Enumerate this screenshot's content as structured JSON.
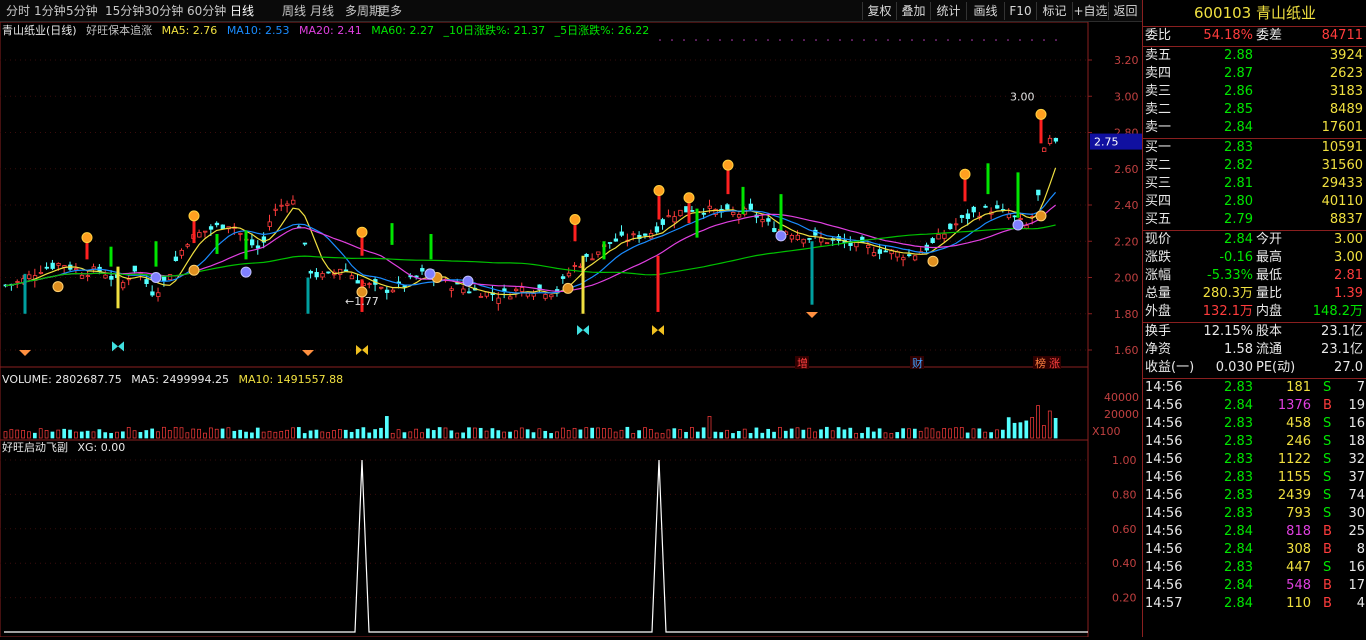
{
  "toolbar": {
    "periods": [
      "分时",
      "1分钟",
      "5分钟",
      "15分钟",
      "30分钟",
      "60分钟",
      "日线",
      "周线",
      "月线",
      "多周期",
      "更多"
    ],
    "active_period": "日线",
    "right_buttons": [
      "复权",
      "叠加",
      "统计",
      "画线",
      "F10",
      "标记",
      "+自选",
      "返回"
    ]
  },
  "header": {
    "code": "600103",
    "name": "青山纸业"
  },
  "main_chart": {
    "title": "青山纸业(日线)",
    "indicator": "好旺保本追涨",
    "ma5": "MA5: 2.76",
    "ma10": "MA10: 2.53",
    "ma20": "MA20: 2.41",
    "ma60": "MA60: 2.27",
    "chg10": "_10日涨跌%: 21.37",
    "chg5": "_5日涨跌%: 26.22",
    "price_ticks": [
      "3.20",
      "3.00",
      "2.80",
      "2.60",
      "2.40",
      "2.20",
      "2.00",
      "1.80",
      "1.60"
    ],
    "current_price_tag": "2.75",
    "high_label": "3.00",
    "low_label": "1.77",
    "markers": [
      "增",
      "财",
      "榜",
      "涨"
    ]
  },
  "volume_chart": {
    "title": "VOLUME: 2802687.75",
    "ma5": "MA5: 2499994.25",
    "ma10": "MA10: 1491557.88",
    "ticks": [
      "40000",
      "20000"
    ],
    "unit": "X100"
  },
  "sub_chart": {
    "title": "好旺启动飞副",
    "xg": "XG: 0.00",
    "ticks": [
      "1.00",
      "0.80",
      "0.60",
      "0.40",
      "0.20"
    ]
  },
  "quote": {
    "weibi_label": "委比",
    "weibi": "54.18%",
    "weicha_label": "委差",
    "weicha": "84711",
    "asks": [
      {
        "label": "卖五",
        "price": "2.88",
        "vol": "3924"
      },
      {
        "label": "卖四",
        "price": "2.87",
        "vol": "2623"
      },
      {
        "label": "卖三",
        "price": "2.86",
        "vol": "3183"
      },
      {
        "label": "卖二",
        "price": "2.85",
        "vol": "8489"
      },
      {
        "label": "卖一",
        "price": "2.84",
        "vol": "17601"
      }
    ],
    "bids": [
      {
        "label": "买一",
        "price": "2.83",
        "vol": "10591"
      },
      {
        "label": "买二",
        "price": "2.82",
        "vol": "31560"
      },
      {
        "label": "买三",
        "price": "2.81",
        "vol": "29433"
      },
      {
        "label": "买四",
        "price": "2.80",
        "vol": "40110"
      },
      {
        "label": "买五",
        "price": "2.79",
        "vol": "8837"
      }
    ],
    "stats": [
      {
        "l1": "现价",
        "v1": "2.84",
        "l2": "今开",
        "v2": "3.00"
      },
      {
        "l1": "涨跌",
        "v1": "-0.16",
        "l2": "最高",
        "v2": "3.00"
      },
      {
        "l1": "涨幅",
        "v1": "-5.33%",
        "l2": "最低",
        "v2": "2.81"
      },
      {
        "l1": "总量",
        "v1": "280.3万",
        "l2": "量比",
        "v2": "1.39"
      },
      {
        "l1": "外盘",
        "v1": "132.1万",
        "l2": "内盘",
        "v2": "148.2万"
      }
    ],
    "stats2": [
      {
        "l1": "换手",
        "v1": "12.15%",
        "l2": "股本",
        "v2": "23.1亿"
      },
      {
        "l1": "净资",
        "v1": "1.58",
        "l2": "流通",
        "v2": "23.1亿"
      },
      {
        "l1": "收益(一)",
        "v1": "0.030",
        "l2": "PE(动)",
        "v2": "27.0"
      }
    ]
  },
  "ticks_list": [
    {
      "time": "14:56",
      "price": "2.83",
      "vol": "181",
      "bs": "S",
      "n": "7"
    },
    {
      "time": "14:56",
      "price": "2.84",
      "vol": "1376",
      "bs": "B",
      "n": "19"
    },
    {
      "time": "14:56",
      "price": "2.83",
      "vol": "458",
      "bs": "S",
      "n": "16"
    },
    {
      "time": "14:56",
      "price": "2.83",
      "vol": "246",
      "bs": "S",
      "n": "18"
    },
    {
      "time": "14:56",
      "price": "2.83",
      "vol": "1122",
      "bs": "S",
      "n": "32"
    },
    {
      "time": "14:56",
      "price": "2.83",
      "vol": "1155",
      "bs": "S",
      "n": "37"
    },
    {
      "time": "14:56",
      "price": "2.83",
      "vol": "2439",
      "bs": "S",
      "n": "74"
    },
    {
      "time": "14:56",
      "price": "2.83",
      "vol": "793",
      "bs": "S",
      "n": "30"
    },
    {
      "time": "14:56",
      "price": "2.84",
      "vol": "818",
      "bs": "B",
      "n": "25"
    },
    {
      "time": "14:56",
      "price": "2.84",
      "vol": "308",
      "bs": "B",
      "n": "8"
    },
    {
      "time": "14:56",
      "price": "2.83",
      "vol": "447",
      "bs": "S",
      "n": "16"
    },
    {
      "time": "14:56",
      "price": "2.84",
      "vol": "548",
      "bs": "B",
      "n": "17"
    },
    {
      "time": "14:57",
      "price": "2.84",
      "vol": "110",
      "bs": "B",
      "n": "4"
    }
  ],
  "colors": {
    "up": "#ff3c3c",
    "down": "#54ffff",
    "ma5": "#ffffff",
    "ma10": "#f0e040",
    "ma20": "#e040e0",
    "ma60": "#00c000",
    "border": "#8a1f1f"
  }
}
